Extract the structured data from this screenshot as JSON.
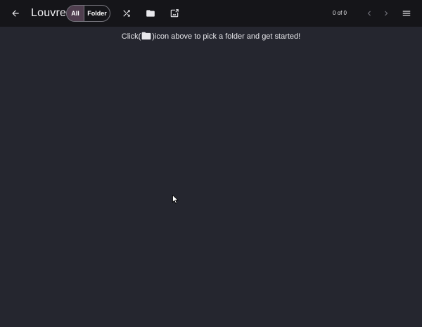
{
  "app": {
    "title": "Louvre"
  },
  "toolbar": {
    "filter_all_label": "All",
    "filter_folder_label": "Folder",
    "counter_text": "0 of 0",
    "icons": [
      "back-arrow-icon",
      "shuffle-icon",
      "folder-icon",
      "image-export-icon",
      "chevron-left-icon",
      "chevron-right-icon",
      "menu-icon"
    ]
  },
  "empty_state": {
    "prefix": "Click(",
    "suffix": ")icon above to pick a folder and get started!",
    "icon": "folder-icon"
  },
  "colors": {
    "background": "#25262f",
    "topbar": "#151519",
    "accent_selected": "#4f3e4e",
    "text": "#e6e6ea"
  }
}
